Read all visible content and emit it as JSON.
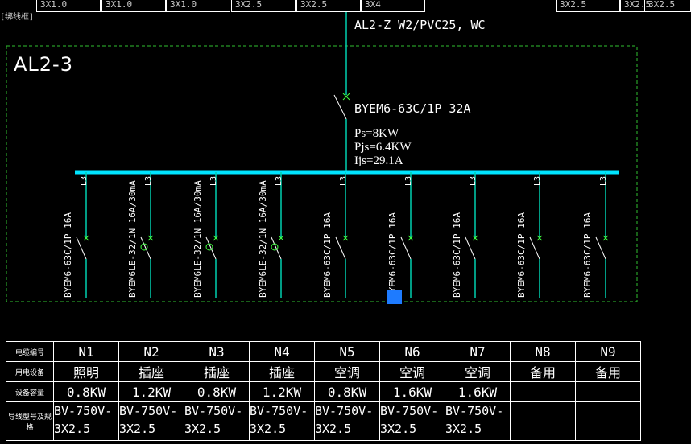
{
  "top_tabs": [
    "3X1.0",
    "3X1.0",
    "3X1.0",
    "3X2.5",
    "3X2.5",
    "3X4",
    "3X2.5",
    "3X2.5",
    "3X2.5"
  ],
  "corner_label": "[绑线框]",
  "panel": {
    "name": "AL2-3",
    "incoming": "AL2-Z W2/PVC25, WC",
    "main_breaker": "BYEM6-63C/1P  32A",
    "ps": "Ps=8KW",
    "pjs": "Pjs=6.4KW",
    "ijs": "Ijs=29.1A"
  },
  "circuits": [
    {
      "phase": "L3",
      "breaker": "BYEM6-63C/1P 16A",
      "rcd": false
    },
    {
      "phase": "L3",
      "breaker": "BYEM6LE-32/1N 16A/30mA",
      "rcd": true
    },
    {
      "phase": "L3",
      "breaker": "BYEM6LE-32/1N 16A/30mA",
      "rcd": true
    },
    {
      "phase": "L3",
      "breaker": "BYEM6LE-32/1N 16A/30mA",
      "rcd": true
    },
    {
      "phase": "L3",
      "breaker": "BYEM6-63C/1P 16A",
      "rcd": false
    },
    {
      "phase": "L3",
      "breaker": "BYEM6-63C/1P 16A",
      "rcd": false
    },
    {
      "phase": "L3",
      "breaker": "BYEM6-63C/1P 16A",
      "rcd": false
    },
    {
      "phase": "L3",
      "breaker": "BYEM6-63C/1P 16A",
      "rcd": false
    },
    {
      "phase": "L3",
      "breaker": "BYEM6-63C/1P 16A",
      "rcd": false
    }
  ],
  "table": {
    "headers": [
      "电缆编号",
      "用电设备",
      "设备容量",
      "导线型号及规格"
    ],
    "circuit_ids": [
      "N1",
      "N2",
      "N3",
      "N4",
      "N5",
      "N6",
      "N7",
      "N8",
      "N9"
    ],
    "loads": [
      "照明",
      "插座",
      "插座",
      "插座",
      "空调",
      "空调",
      "空调",
      "备用",
      "备用"
    ],
    "capacities": [
      "0.8KW",
      "1.2KW",
      "0.8KW",
      "1.2KW",
      "0.8KW",
      "1.6KW",
      "1.6KW",
      "",
      ""
    ],
    "wire_type": [
      "BV-750V-",
      "BV-750V-",
      "BV-750V-",
      "BV-750V-",
      "BV-750V-",
      "BV-750V-",
      "BV-750V-",
      "",
      ""
    ],
    "wire_size": [
      "3X2.5",
      "3X2.5",
      "3X2.5",
      "3X2.5",
      "3X2.5",
      "3X2.5",
      "3X2.5",
      "",
      ""
    ]
  },
  "colors": {
    "bus": "#00e5ff",
    "wire": "#00d0b0",
    "frame": "#2fbf2f",
    "switch": "#40ff40",
    "selection": "#1e7bff"
  }
}
